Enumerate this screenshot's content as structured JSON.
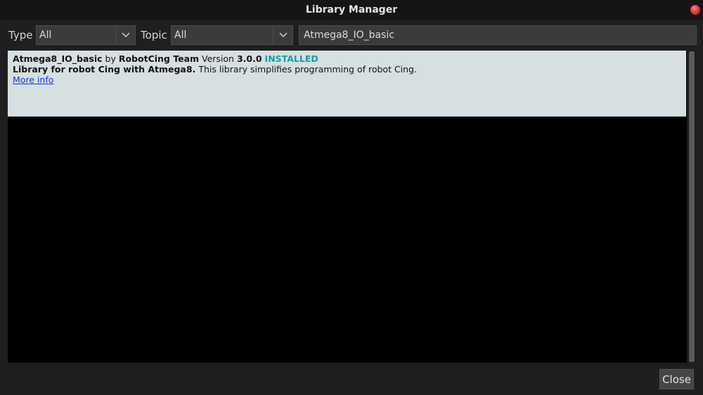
{
  "window": {
    "title": "Library Manager"
  },
  "filters": {
    "type_label": "Type",
    "type_value": "All",
    "topic_label": "Topic",
    "topic_value": "All",
    "search_value": "Atmega8_IO_basic"
  },
  "results": [
    {
      "name": "Atmega8_IO_basic",
      "by": "by",
      "author": "RobotCing Team",
      "version_label": "Version",
      "version": "3.0.0",
      "status": "INSTALLED",
      "sentence_bold": "Library for robot Cing with Atmega8.",
      "sentence": "This library simplifies programming of robot Cing.",
      "more_info": "More info"
    }
  ],
  "footer": {
    "close_label": "Close"
  },
  "colors": {
    "installed": "#12a0a8",
    "item_bg": "#d6dfe1",
    "link": "#1a36d6"
  },
  "icons": {
    "window_close": "red-circle-icon",
    "dropdown": "chevron-down-icon"
  }
}
